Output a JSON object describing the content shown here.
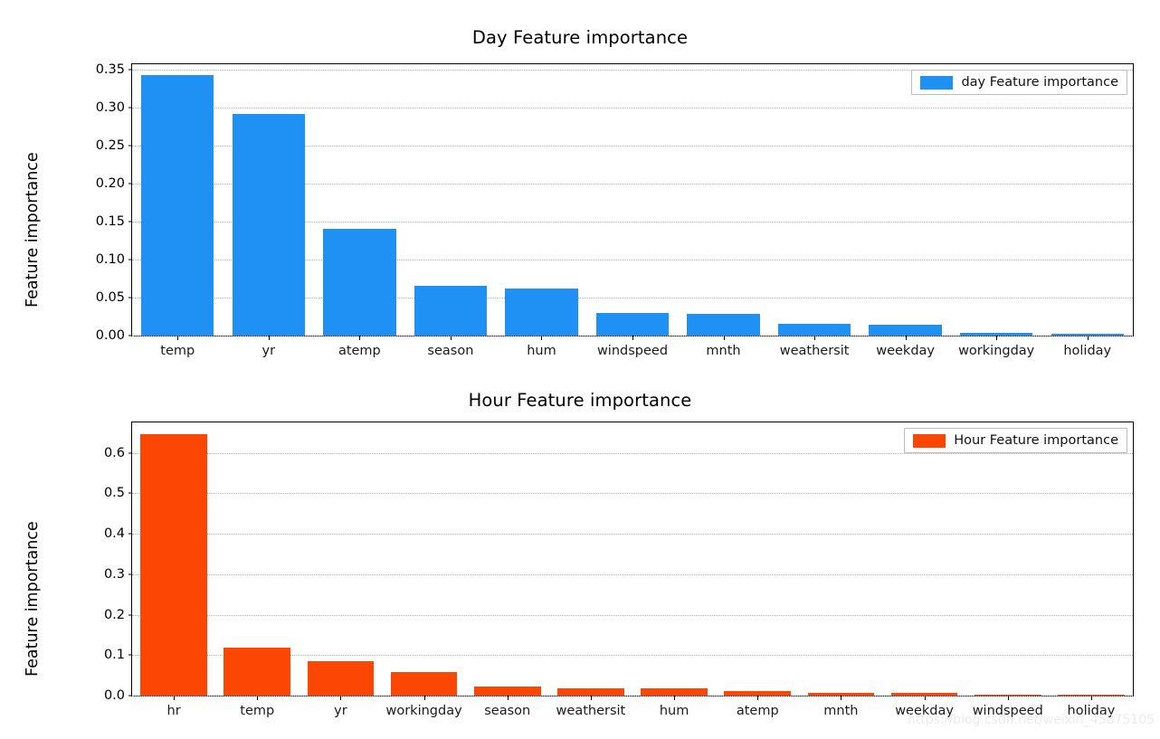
{
  "watermark": "https://blog.csdn.net/weixin_45875105",
  "panels": [
    {
      "title": "Day Feature importance",
      "ylabel": "Feature importance",
      "legend": "day Feature importance",
      "color": "#1f91f5"
    },
    {
      "title": "Hour Feature importance",
      "ylabel": "Feature importance",
      "legend": "Hour Feature importance",
      "color": "#fc4604"
    }
  ],
  "chart_data": [
    {
      "type": "bar",
      "title": "Day Feature importance",
      "xlabel": "",
      "ylabel": "Feature importance",
      "categories": [
        "temp",
        "yr",
        "atemp",
        "season",
        "hum",
        "windspeed",
        "mnth",
        "weathersit",
        "weekday",
        "workingday",
        "holiday"
      ],
      "values": [
        0.343,
        0.291,
        0.141,
        0.065,
        0.062,
        0.03,
        0.029,
        0.016,
        0.014,
        0.004,
        0.002
      ],
      "series": [
        {
          "name": "day Feature importance",
          "color": "#1f91f5",
          "values": [
            0.343,
            0.291,
            0.141,
            0.065,
            0.062,
            0.03,
            0.029,
            0.016,
            0.014,
            0.004,
            0.002
          ]
        }
      ],
      "yticks": [
        "0.00",
        "0.05",
        "0.10",
        "0.15",
        "0.20",
        "0.25",
        "0.30",
        "0.35"
      ],
      "ytickvalues": [
        0.0,
        0.05,
        0.1,
        0.15,
        0.2,
        0.25,
        0.3,
        0.35
      ],
      "ylim": [
        0.0,
        0.357
      ],
      "grid": true,
      "legend": [
        "day Feature importance"
      ],
      "legend_position": "upper right"
    },
    {
      "type": "bar",
      "title": "Hour Feature importance",
      "xlabel": "",
      "ylabel": "Feature importance",
      "categories": [
        "hr",
        "temp",
        "yr",
        "workingday",
        "season",
        "weathersit",
        "hum",
        "atemp",
        "mnth",
        "weekday",
        "windspeed",
        "holiday"
      ],
      "values": [
        0.647,
        0.119,
        0.086,
        0.059,
        0.022,
        0.017,
        0.017,
        0.012,
        0.0075,
        0.0075,
        0.002,
        0.0015
      ],
      "series": [
        {
          "name": "Hour Feature importance",
          "color": "#fc4604",
          "values": [
            0.647,
            0.119,
            0.086,
            0.059,
            0.022,
            0.017,
            0.017,
            0.012,
            0.0075,
            0.0075,
            0.002,
            0.0015
          ]
        }
      ],
      "yticks": [
        "0.0",
        "0.1",
        "0.2",
        "0.3",
        "0.4",
        "0.5",
        "0.6"
      ],
      "ytickvalues": [
        0.0,
        0.1,
        0.2,
        0.3,
        0.4,
        0.5,
        0.6
      ],
      "ylim": [
        0.0,
        0.675
      ],
      "grid": true,
      "legend": [
        "Hour Feature importance"
      ],
      "legend_position": "upper right"
    }
  ]
}
